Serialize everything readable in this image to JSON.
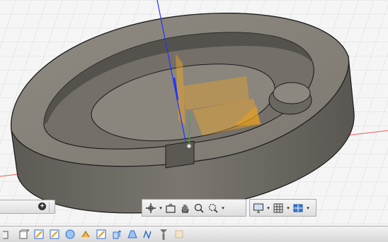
{
  "viewport": {
    "name": "3d-modeling-viewport",
    "colors": {
      "grid_background": "#f5f5f5",
      "grid_line": "#d4d4d4",
      "model_face": "#8a867d",
      "model_wall": "#6e6a63",
      "selection_fill": "#f5a623",
      "axis_y": "#2233ff",
      "axis_z": "#22bb22",
      "axis_x": "#ee3333"
    }
  },
  "browser_panel": {
    "expand_icon": "plus-circle-icon"
  },
  "navigation_toolbar": {
    "tools": [
      "orbit-icon",
      "look-at-icon",
      "pan-icon",
      "zoom-icon",
      "fit-icon"
    ]
  },
  "display_toolbar": {
    "tools": [
      "display-settings-icon",
      "grid-settings-icon",
      "viewports-icon"
    ]
  },
  "timeline": {
    "features": [
      "box-icon",
      "cylinder-icon",
      "sketch-icon",
      "sketch-icon",
      "sphere-icon",
      "revolve-icon",
      "sketch-icon",
      "extrude-icon",
      "loft-icon",
      "sweep-icon",
      "marker-icon",
      "ghost-feature-icon"
    ]
  }
}
